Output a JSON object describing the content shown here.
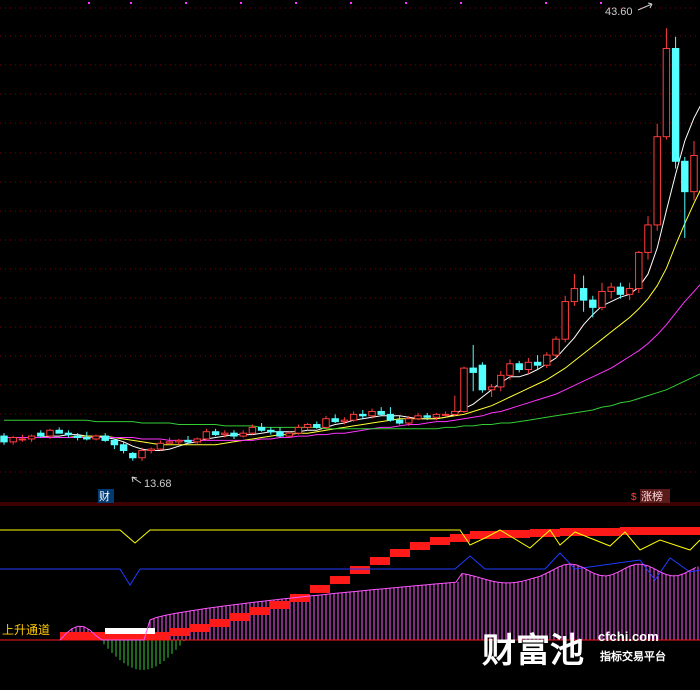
{
  "chart_data": {
    "type": "candlestick",
    "colors": {
      "up": "#ff3d3d",
      "down": "#54ffff",
      "ma5": "#ffffff",
      "ma10": "#ffff33",
      "ma20": "#ff33ff",
      "ma60": "#33cc33",
      "grid": "#7a0000",
      "bg": "#000000",
      "channel": "#ff1a1a",
      "yellow_line": "#ffff00",
      "blue_line": "#1f3cff",
      "magenta_bars": "#ff55ff",
      "green_bars": "#33cc33"
    },
    "price_range": [
      12.5,
      45.0
    ],
    "candles": [
      {
        "o": 15.4,
        "h": 15.6,
        "l": 14.8,
        "c": 15.0
      },
      {
        "o": 15.0,
        "h": 15.4,
        "l": 14.8,
        "c": 15.3
      },
      {
        "o": 15.2,
        "h": 15.5,
        "l": 15.0,
        "c": 15.2
      },
      {
        "o": 15.2,
        "h": 15.5,
        "l": 15.0,
        "c": 15.4
      },
      {
        "o": 15.6,
        "h": 15.8,
        "l": 15.3,
        "c": 15.4
      },
      {
        "o": 15.4,
        "h": 15.9,
        "l": 15.2,
        "c": 15.8
      },
      {
        "o": 15.8,
        "h": 16.0,
        "l": 15.6,
        "c": 15.6
      },
      {
        "o": 15.6,
        "h": 15.8,
        "l": 15.3,
        "c": 15.5
      },
      {
        "o": 15.4,
        "h": 15.6,
        "l": 15.1,
        "c": 15.3
      },
      {
        "o": 15.3,
        "h": 15.7,
        "l": 15.1,
        "c": 15.2
      },
      {
        "o": 15.2,
        "h": 15.5,
        "l": 15.1,
        "c": 15.4
      },
      {
        "o": 15.4,
        "h": 15.6,
        "l": 15.0,
        "c": 15.1
      },
      {
        "o": 15.1,
        "h": 15.2,
        "l": 14.5,
        "c": 14.8
      },
      {
        "o": 14.8,
        "h": 15.0,
        "l": 14.2,
        "c": 14.4
      },
      {
        "o": 14.2,
        "h": 14.3,
        "l": 13.7,
        "c": 13.9
      },
      {
        "o": 13.9,
        "h": 14.6,
        "l": 13.68,
        "c": 14.4
      },
      {
        "o": 14.4,
        "h": 14.6,
        "l": 14.2,
        "c": 14.5
      },
      {
        "o": 14.5,
        "h": 15.1,
        "l": 14.4,
        "c": 14.9
      },
      {
        "o": 14.9,
        "h": 15.3,
        "l": 14.8,
        "c": 15.0
      },
      {
        "o": 15.0,
        "h": 15.2,
        "l": 14.8,
        "c": 15.1
      },
      {
        "o": 15.1,
        "h": 15.4,
        "l": 14.9,
        "c": 15.0
      },
      {
        "o": 15.0,
        "h": 15.3,
        "l": 14.8,
        "c": 15.2
      },
      {
        "o": 15.2,
        "h": 15.9,
        "l": 15.1,
        "c": 15.7
      },
      {
        "o": 15.7,
        "h": 15.9,
        "l": 15.4,
        "c": 15.5
      },
      {
        "o": 15.5,
        "h": 15.8,
        "l": 15.3,
        "c": 15.6
      },
      {
        "o": 15.6,
        "h": 15.8,
        "l": 15.2,
        "c": 15.4
      },
      {
        "o": 15.4,
        "h": 15.8,
        "l": 15.3,
        "c": 15.6
      },
      {
        "o": 15.6,
        "h": 16.2,
        "l": 15.5,
        "c": 16.0
      },
      {
        "o": 16.0,
        "h": 16.3,
        "l": 15.7,
        "c": 15.8
      },
      {
        "o": 15.8,
        "h": 16.0,
        "l": 15.5,
        "c": 15.7
      },
      {
        "o": 15.7,
        "h": 16.0,
        "l": 15.3,
        "c": 15.4
      },
      {
        "o": 15.4,
        "h": 15.7,
        "l": 15.3,
        "c": 15.6
      },
      {
        "o": 15.6,
        "h": 16.2,
        "l": 15.5,
        "c": 16.0
      },
      {
        "o": 16.0,
        "h": 16.3,
        "l": 15.8,
        "c": 16.2
      },
      {
        "o": 16.2,
        "h": 16.4,
        "l": 15.9,
        "c": 16.0
      },
      {
        "o": 16.0,
        "h": 16.8,
        "l": 15.9,
        "c": 16.6
      },
      {
        "o": 16.6,
        "h": 16.9,
        "l": 16.3,
        "c": 16.4
      },
      {
        "o": 16.4,
        "h": 16.7,
        "l": 16.2,
        "c": 16.5
      },
      {
        "o": 16.5,
        "h": 17.1,
        "l": 16.4,
        "c": 16.9
      },
      {
        "o": 16.9,
        "h": 17.2,
        "l": 16.6,
        "c": 16.8
      },
      {
        "o": 16.8,
        "h": 17.3,
        "l": 16.6,
        "c": 17.1
      },
      {
        "o": 17.1,
        "h": 17.4,
        "l": 16.8,
        "c": 16.9
      },
      {
        "o": 16.9,
        "h": 17.4,
        "l": 16.4,
        "c": 16.5
      },
      {
        "o": 16.5,
        "h": 16.8,
        "l": 16.2,
        "c": 16.3
      },
      {
        "o": 16.3,
        "h": 16.8,
        "l": 16.1,
        "c": 16.6
      },
      {
        "o": 16.6,
        "h": 17.0,
        "l": 16.5,
        "c": 16.8
      },
      {
        "o": 16.8,
        "h": 17.0,
        "l": 16.5,
        "c": 16.7
      },
      {
        "o": 16.7,
        "h": 17.0,
        "l": 16.5,
        "c": 16.9
      },
      {
        "o": 16.9,
        "h": 17.1,
        "l": 16.7,
        "c": 16.9
      },
      {
        "o": 16.9,
        "h": 18.2,
        "l": 16.8,
        "c": 17.1
      },
      {
        "o": 17.1,
        "h": 20.2,
        "l": 17.0,
        "c": 20.1
      },
      {
        "o": 20.1,
        "h": 21.7,
        "l": 18.5,
        "c": 19.8
      },
      {
        "o": 20.3,
        "h": 20.5,
        "l": 18.4,
        "c": 18.6
      },
      {
        "o": 18.6,
        "h": 19.0,
        "l": 18.1,
        "c": 18.8
      },
      {
        "o": 18.8,
        "h": 19.9,
        "l": 18.5,
        "c": 19.6
      },
      {
        "o": 19.6,
        "h": 20.7,
        "l": 19.3,
        "c": 20.4
      },
      {
        "o": 20.4,
        "h": 20.6,
        "l": 19.8,
        "c": 20.0
      },
      {
        "o": 20.0,
        "h": 20.8,
        "l": 19.7,
        "c": 20.5
      },
      {
        "o": 20.5,
        "h": 21.0,
        "l": 20.0,
        "c": 20.3
      },
      {
        "o": 20.3,
        "h": 21.2,
        "l": 20.1,
        "c": 21.0
      },
      {
        "o": 21.0,
        "h": 22.3,
        "l": 20.8,
        "c": 22.1
      },
      {
        "o": 22.1,
        "h": 25.1,
        "l": 21.9,
        "c": 24.7
      },
      {
        "o": 24.7,
        "h": 26.6,
        "l": 24.4,
        "c": 25.6
      },
      {
        "o": 25.6,
        "h": 26.5,
        "l": 24.0,
        "c": 24.8
      },
      {
        "o": 24.8,
        "h": 25.1,
        "l": 23.6,
        "c": 24.3
      },
      {
        "o": 24.3,
        "h": 26.0,
        "l": 24.1,
        "c": 25.4
      },
      {
        "o": 25.4,
        "h": 26.0,
        "l": 24.9,
        "c": 25.7
      },
      {
        "o": 25.7,
        "h": 26.0,
        "l": 24.9,
        "c": 25.2
      },
      {
        "o": 25.2,
        "h": 26.0,
        "l": 24.8,
        "c": 25.6
      },
      {
        "o": 25.6,
        "h": 28.2,
        "l": 25.3,
        "c": 28.1
      },
      {
        "o": 28.1,
        "h": 30.6,
        "l": 27.6,
        "c": 30.0
      },
      {
        "o": 30.0,
        "h": 37.0,
        "l": 29.6,
        "c": 36.1
      },
      {
        "o": 36.1,
        "h": 43.6,
        "l": 35.9,
        "c": 42.2
      },
      {
        "o": 42.2,
        "h": 43.0,
        "l": 33.9,
        "c": 34.4
      },
      {
        "o": 34.4,
        "h": 34.7,
        "l": 29.1,
        "c": 32.3
      },
      {
        "o": 32.3,
        "h": 35.8,
        "l": 31.7,
        "c": 34.8
      }
    ],
    "ma_lines": [
      {
        "name": "MA5",
        "values": [
          15.3,
          15.3,
          15.3,
          15.3,
          15.3,
          15.4,
          15.4,
          15.5,
          15.5,
          15.4,
          15.4,
          15.3,
          15.2,
          15.0,
          14.7,
          14.5,
          14.4,
          14.4,
          14.5,
          14.7,
          14.9,
          15.0,
          15.2,
          15.3,
          15.4,
          15.5,
          15.5,
          15.5,
          15.6,
          15.7,
          15.7,
          15.7,
          15.7,
          15.8,
          15.8,
          16.0,
          16.2,
          16.3,
          16.5,
          16.6,
          16.7,
          16.8,
          16.8,
          16.8,
          16.7,
          16.6,
          16.6,
          16.6,
          16.7,
          16.9,
          17.3,
          17.6,
          18.1,
          18.6,
          19.1,
          19.5,
          19.5,
          19.7,
          20.0,
          20.4,
          20.8,
          21.5,
          22.2,
          23.1,
          23.8,
          24.4,
          24.7,
          25.0,
          25.2,
          25.7,
          26.6,
          28.4,
          31.0,
          33.5,
          35.8,
          37.4,
          38.6
        ]
      },
      {
        "name": "MA10",
        "values": [
          15.3,
          15.3,
          15.3,
          15.3,
          15.3,
          15.3,
          15.3,
          15.3,
          15.4,
          15.4,
          15.4,
          15.4,
          15.3,
          15.2,
          15.1,
          15.0,
          14.9,
          14.8,
          14.8,
          14.8,
          14.8,
          14.8,
          14.8,
          14.8,
          14.9,
          15.0,
          15.1,
          15.2,
          15.3,
          15.4,
          15.5,
          15.5,
          15.6,
          15.6,
          15.7,
          15.8,
          15.9,
          16.0,
          16.1,
          16.2,
          16.3,
          16.4,
          16.5,
          16.6,
          16.6,
          16.6,
          16.6,
          16.6,
          16.7,
          16.8,
          16.9,
          17.1,
          17.3,
          17.5,
          17.8,
          18.1,
          18.4,
          18.7,
          19.0,
          19.3,
          19.7,
          20.1,
          20.6,
          21.1,
          21.6,
          22.1,
          22.6,
          23.1,
          23.6,
          24.2,
          24.9,
          25.8,
          27.0,
          28.6,
          30.1,
          31.5,
          32.8
        ]
      },
      {
        "name": "MA20",
        "values": [
          15.3,
          15.3,
          15.3,
          15.3,
          15.3,
          15.3,
          15.3,
          15.3,
          15.3,
          15.3,
          15.3,
          15.3,
          15.3,
          15.3,
          15.3,
          15.2,
          15.2,
          15.2,
          15.1,
          15.1,
          15.1,
          15.1,
          15.1,
          15.1,
          15.1,
          15.1,
          15.1,
          15.1,
          15.2,
          15.2,
          15.3,
          15.3,
          15.4,
          15.4,
          15.5,
          15.5,
          15.6,
          15.6,
          15.7,
          15.8,
          15.9,
          16.0,
          16.0,
          16.1,
          16.2,
          16.2,
          16.3,
          16.4,
          16.4,
          16.5,
          16.6,
          16.7,
          16.8,
          17.0,
          17.1,
          17.3,
          17.5,
          17.7,
          17.9,
          18.1,
          18.3,
          18.6,
          18.9,
          19.2,
          19.5,
          19.8,
          20.1,
          20.5,
          20.9,
          21.3,
          21.8,
          22.4,
          23.1,
          23.9,
          24.7,
          25.4,
          26.1
        ]
      },
      {
        "name": "MA60",
        "values": [
          16.5,
          16.5,
          16.5,
          16.5,
          16.5,
          16.5,
          16.5,
          16.5,
          16.5,
          16.5,
          16.4,
          16.4,
          16.4,
          16.4,
          16.4,
          16.3,
          16.3,
          16.3,
          16.3,
          16.2,
          16.2,
          16.2,
          16.2,
          16.2,
          16.1,
          16.1,
          16.1,
          16.1,
          16.0,
          16.0,
          16.0,
          16.0,
          16.0,
          16.0,
          16.0,
          15.9,
          15.9,
          15.9,
          15.9,
          15.9,
          15.9,
          15.9,
          15.9,
          15.9,
          15.9,
          15.9,
          15.9,
          15.9,
          16.0,
          16.0,
          16.1,
          16.1,
          16.2,
          16.2,
          16.3,
          16.3,
          16.4,
          16.5,
          16.6,
          16.7,
          16.8,
          16.9,
          17.0,
          17.1,
          17.2,
          17.4,
          17.5,
          17.7,
          17.8,
          18.0,
          18.2,
          18.4,
          18.6,
          18.9,
          19.2,
          19.5,
          19.8
        ]
      }
    ],
    "annotations": {
      "high_label": "43.60",
      "low_label": "13.68",
      "marker_left": "财",
      "marker_right": "涨榜",
      "marker_right_prefix": "$",
      "indicator_label": "上升通道"
    }
  },
  "watermark": {
    "brand": "财富池",
    "domain": "cfchi.com",
    "slogan": "指标交易平台"
  }
}
